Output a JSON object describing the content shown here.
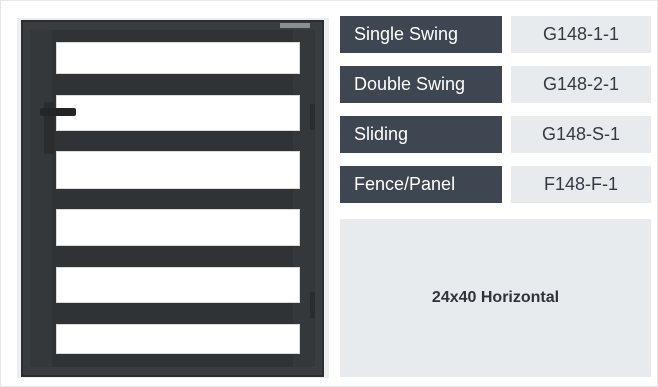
{
  "product": {
    "image_alt": "Black horizontal slat gate"
  },
  "options": [
    {
      "label": "Single Swing",
      "code": "G148-1-1"
    },
    {
      "label": "Double Swing",
      "code": "G148-2-1"
    },
    {
      "label": "Sliding",
      "code": "G148-S-1"
    },
    {
      "label": "Fence/Panel",
      "code": "F148-F-1"
    }
  ],
  "size": {
    "label": "24x40 Horizontal"
  },
  "colors": {
    "label_bg": "#3d4651",
    "code_bg": "#e8ebee",
    "gate_frame": "#3a3d40"
  }
}
